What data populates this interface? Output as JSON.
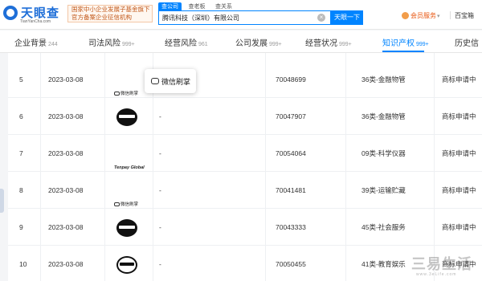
{
  "header": {
    "logo_text": "天眼查",
    "logo_sub": "TianYanCha.com",
    "badge_line1": "国家中小企业发展子基金旗下",
    "badge_line2": "官方备案企业征信机构",
    "search_tabs": [
      "查公司",
      "查老板",
      "查关系"
    ],
    "search_value": "腾讯科技（深圳）有限公司",
    "search_button": "天眼一下",
    "member_label": "会员服务",
    "user_label": "百宝箱"
  },
  "tabs": [
    {
      "label": "企业背景",
      "count": "244"
    },
    {
      "label": "司法风险",
      "count": "999+"
    },
    {
      "label": "经营风险",
      "count": "961"
    },
    {
      "label": "公司发展",
      "count": "999+"
    },
    {
      "label": "经营状况",
      "count": "999+"
    },
    {
      "label": "知识产权",
      "count": "999+"
    },
    {
      "label": "历史信",
      "count": ""
    }
  ],
  "active_tab": "知识产权",
  "rows": [
    {
      "index": "5",
      "date": "2023-03-08",
      "logo": "微信刷掌",
      "name": "",
      "reg_no": "70048699",
      "class": "36类-金融物管",
      "status": "商标申请中"
    },
    {
      "index": "6",
      "date": "2023-03-08",
      "logo": "graphic-disc",
      "name": "-",
      "reg_no": "70047907",
      "class": "36类-金融物管",
      "status": "商标申请中"
    },
    {
      "index": "7",
      "date": "2023-03-08",
      "logo": "Tenpay Global",
      "name": "-",
      "reg_no": "70054064",
      "class": "09类-科学仪器",
      "status": "商标申请中"
    },
    {
      "index": "8",
      "date": "2023-03-08",
      "logo": "微信刷掌",
      "name": "-",
      "reg_no": "70041481",
      "class": "39类-运输贮藏",
      "status": "商标申请中"
    },
    {
      "index": "9",
      "date": "2023-03-08",
      "logo": "graphic-disc",
      "name": "-",
      "reg_no": "70043333",
      "class": "45类-社会服务",
      "status": "商标申请中"
    },
    {
      "index": "10",
      "date": "2023-03-08",
      "logo": "graphic-ring",
      "name": "-",
      "reg_no": "70050455",
      "class": "41类-教育娱乐",
      "status": "商标申请中"
    }
  ],
  "popover": {
    "label": "微信刷掌"
  },
  "watermark": {
    "main": "三易生活",
    "sub": "www.3eLife.com"
  },
  "colors": {
    "accent": "#0084ff",
    "member": "#e8540e",
    "badge": "#c2581a"
  }
}
